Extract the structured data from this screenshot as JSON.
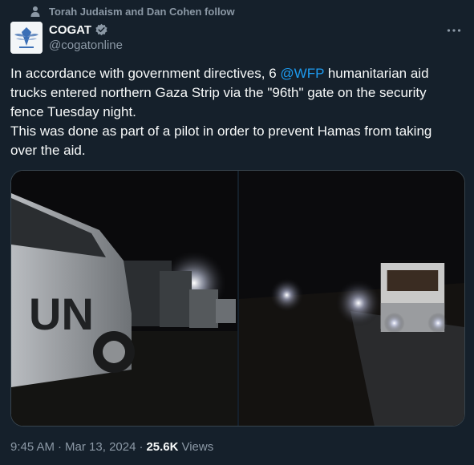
{
  "social_context": {
    "text": "Torah Judaism and Dan Cohen follow",
    "icon": "person-icon"
  },
  "author": {
    "name": "COGAT",
    "handle": "@cogatonline",
    "verified": true,
    "verified_color": "#8b98a5"
  },
  "menu": {
    "icon": "more-horizontal-icon"
  },
  "tweet": {
    "line1_pre": "In accordance with government directives, 6 ",
    "mention": "@WFP",
    "line1_post": " humanitarian aid trucks entered northern Gaza Strip via the \"96th\" gate on the security fence Tuesday night.",
    "line2": "This was done as part of a pilot in order to prevent Hamas from taking over the aid."
  },
  "media": {
    "left_photo_text": "UN"
  },
  "meta": {
    "time": "9:45 AM",
    "date": "Mar 13, 2024",
    "separator": "·",
    "views_count": "25.6K",
    "views_label": "Views"
  },
  "colors": {
    "background": "#15202b",
    "text": "#f7f9f9",
    "secondary": "#8b98a5",
    "link": "#1d9bf0",
    "border": "#38444d"
  }
}
